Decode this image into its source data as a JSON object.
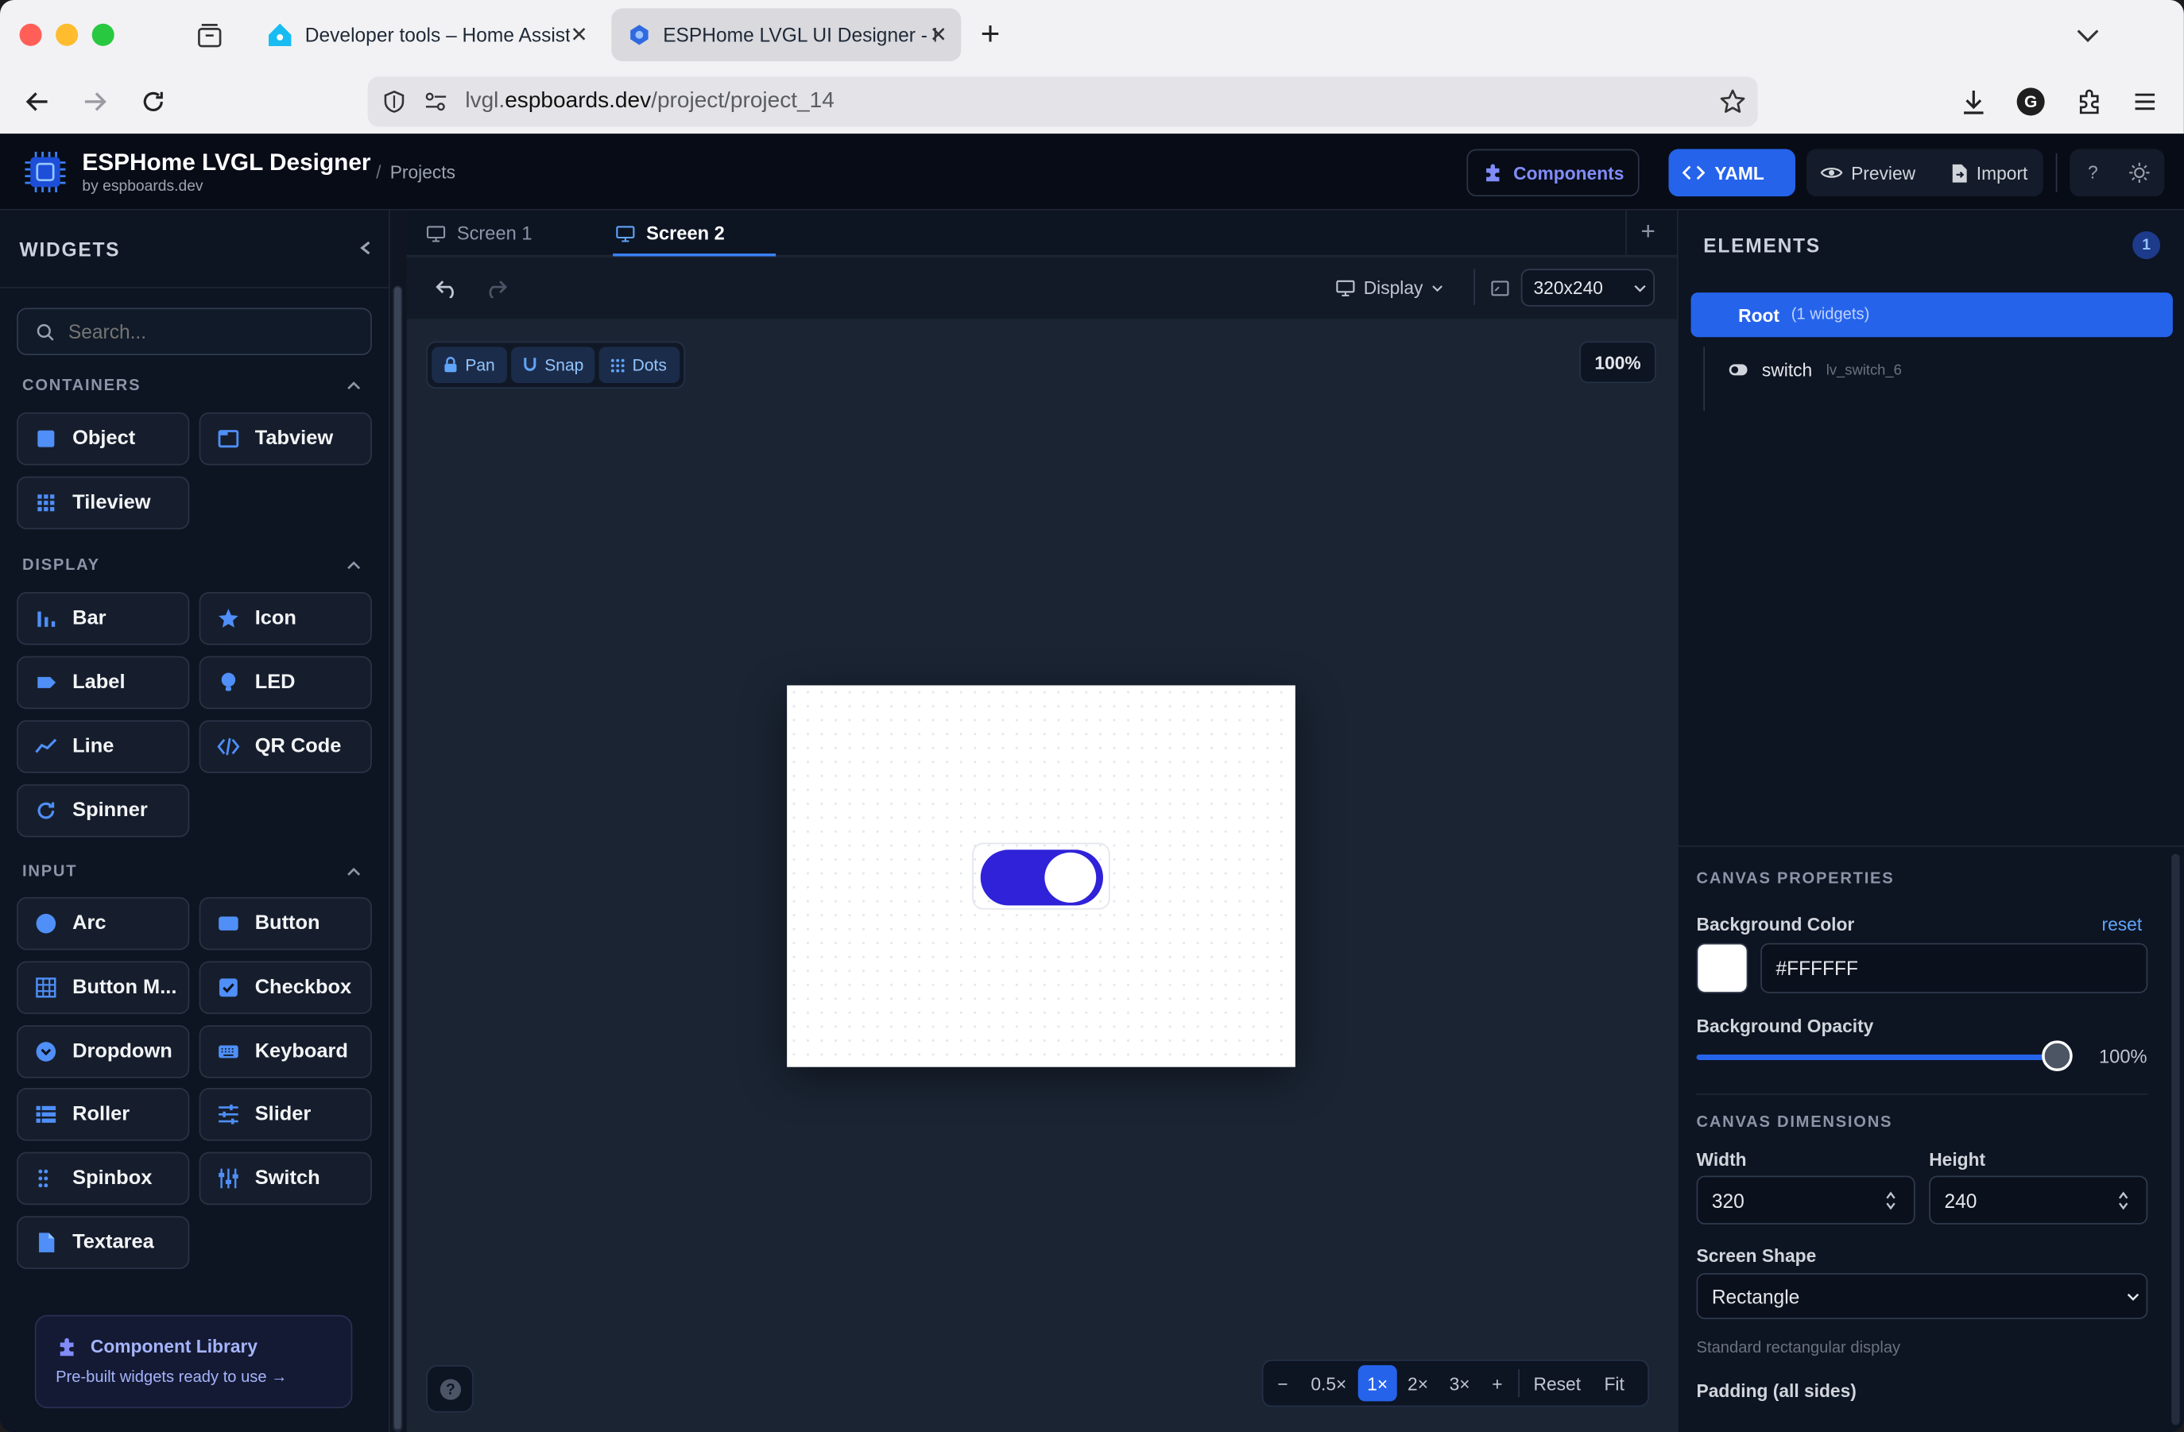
{
  "browser": {
    "tabs": [
      {
        "title": "Developer tools – Home Assistant"
      },
      {
        "title": "ESPHome LVGL UI Designer - Free"
      }
    ],
    "url": {
      "prefix": "lvgl.",
      "domain": "espboards.dev",
      "path": "/project/project_14"
    },
    "profile_initial": "G"
  },
  "header": {
    "app_title": "ESPHome LVGL Designer",
    "app_subtitle": "by espboards.dev",
    "breadcrumb_sep": "/",
    "breadcrumb": "Projects",
    "components_label": "Components",
    "yaml_label": "YAML",
    "preview_label": "Preview",
    "import_label": "Import",
    "help_label": "?"
  },
  "sidebar": {
    "title": "WIDGETS",
    "search_placeholder": "Search...",
    "sections": [
      {
        "title": "CONTAINERS",
        "items": [
          {
            "label": "Object",
            "icon": "square-icon"
          },
          {
            "label": "Tabview",
            "icon": "tabview-icon"
          },
          {
            "label": "Tileview",
            "icon": "grid-icon"
          }
        ]
      },
      {
        "title": "DISPLAY",
        "items": [
          {
            "label": "Bar",
            "icon": "bar-chart-icon"
          },
          {
            "label": "Icon",
            "icon": "star-icon"
          },
          {
            "label": "Label",
            "icon": "tag-icon"
          },
          {
            "label": "LED",
            "icon": "bulb-icon"
          },
          {
            "label": "Line",
            "icon": "line-icon"
          },
          {
            "label": "QR Code",
            "icon": "code-icon"
          },
          {
            "label": "Spinner",
            "icon": "refresh-icon"
          }
        ]
      },
      {
        "title": "INPUT",
        "items": [
          {
            "label": "Arc",
            "icon": "circle-icon"
          },
          {
            "label": "Button",
            "icon": "button-icon"
          },
          {
            "label": "Button M...",
            "icon": "button-matrix-icon"
          },
          {
            "label": "Checkbox",
            "icon": "checkbox-icon"
          },
          {
            "label": "Dropdown",
            "icon": "dropdown-icon"
          },
          {
            "label": "Keyboard",
            "icon": "keyboard-icon"
          },
          {
            "label": "Roller",
            "icon": "list-icon"
          },
          {
            "label": "Slider",
            "icon": "sliders-icon"
          },
          {
            "label": "Spinbox",
            "icon": "dots-icon"
          },
          {
            "label": "Switch",
            "icon": "toggle-icon"
          },
          {
            "label": "Textarea",
            "icon": "document-icon"
          }
        ]
      }
    ],
    "library": {
      "title": "Component Library",
      "subtitle": "Pre-built widgets ready to use →"
    }
  },
  "canvas": {
    "tabs": [
      {
        "label": "Screen 1"
      },
      {
        "label": "Screen 2",
        "active": true
      }
    ],
    "display_label": "Display",
    "resolution": "320x240",
    "zoom_percent": "100%",
    "modes": {
      "pan": "Pan",
      "snap": "Snap",
      "dots": "Dots"
    },
    "switch_state": "on",
    "zoom_controls": {
      "minus": "−",
      "z05": "0.5×",
      "z1": "1×",
      "z2": "2×",
      "z3": "3×",
      "plus": "+",
      "reset": "Reset",
      "fit": "Fit"
    },
    "accent": "#2563eb",
    "switch_color": "#2f22d9"
  },
  "elements": {
    "title": "ELEMENTS",
    "count": "1",
    "root_label": "Root",
    "root_meta": "(1 widgets)",
    "children": [
      {
        "name": "switch",
        "id": "lv_switch_6"
      }
    ]
  },
  "properties": {
    "section_canvas": "CANVAS PROPERTIES",
    "bg_color_label": "Background Color",
    "reset_label": "reset",
    "bg_color_value": "#FFFFFF",
    "bg_opacity_label": "Background Opacity",
    "bg_opacity_value": "100%",
    "bg_opacity_fraction": 1.0,
    "section_dimensions": "CANVAS DIMENSIONS",
    "width_label": "Width",
    "width_value": "320",
    "height_label": "Height",
    "height_value": "240",
    "shape_label": "Screen Shape",
    "shape_value": "Rectangle",
    "shape_hint": "Standard rectangular display",
    "padding_label": "Padding (all sides)"
  }
}
